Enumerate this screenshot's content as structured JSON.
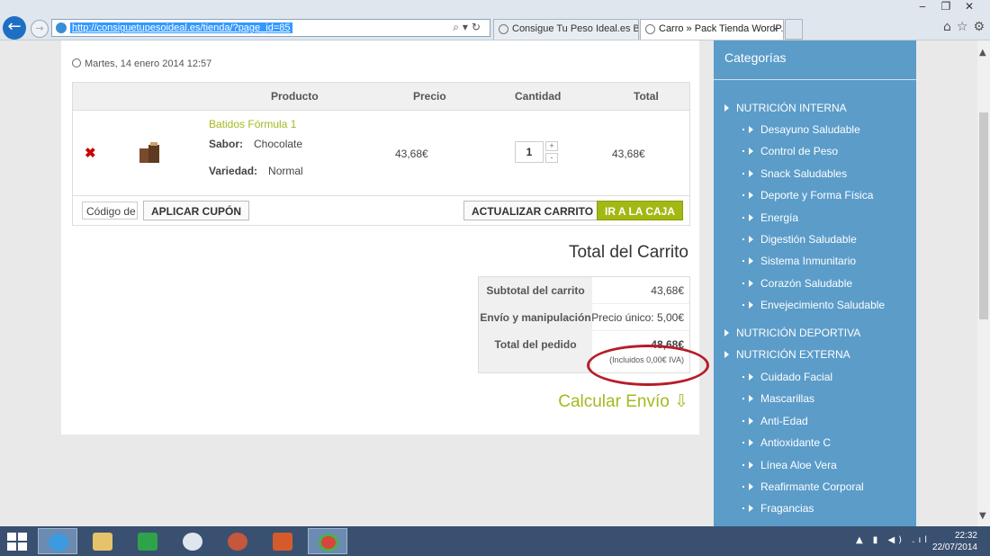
{
  "browser": {
    "url": "http://consiguetupesoideal.es/tienda/?page_id=85",
    "tabs": [
      {
        "label": "Consigue Tu Peso Ideal.es Bus..."
      },
      {
        "label": "Carro » Pack Tienda WordP..."
      }
    ],
    "win_controls": {
      "minimize": "‒",
      "restore": "❐",
      "close": "✕"
    },
    "nav_icons": {
      "home": "⌂",
      "favorites": "☆",
      "settings": "⚙"
    }
  },
  "page": {
    "date": "Martes, 14 enero 2014 12:57",
    "cart": {
      "headers": {
        "product": "Producto",
        "price": "Precio",
        "quantity": "Cantidad",
        "total": "Total"
      },
      "item": {
        "name": "Batidos Fórmula 1",
        "flavor_label": "Sabor:",
        "flavor_value": "Chocolate",
        "variety_label": "Variedad:",
        "variety_value": "Normal",
        "price": "43,68€",
        "quantity": "1",
        "total": "43,68€",
        "remove": "✖"
      },
      "coupon_placeholder": "Código de",
      "apply_coupon": "APLICAR CUPÓN",
      "update_cart": "ACTUALIZAR CARRITO",
      "checkout": "IR A LA CAJA"
    },
    "totals": {
      "title": "Total del Carrito",
      "subtotal_label": "Subtotal del carrito",
      "subtotal_value": "43,68€",
      "shipping_label": "Envío y manipulación",
      "shipping_value": "Precio único: 5,00€",
      "order_total_label": "Total del pedido",
      "order_total_value": "48,68€",
      "tax_note": "(Incluidos 0,00€ IVA)"
    },
    "calc_shipping": "Calcular Envío",
    "calc_arrow": "⇩"
  },
  "sidebar": {
    "title": "Categorías",
    "categories": [
      "NUTRICIÓN INTERNA",
      "Desayuno Saludable",
      "Control de Peso",
      "Snack Saludables",
      "Deporte y Forma Física",
      "Energía",
      "Digestión Saludable",
      "Sistema Inmunitario",
      "Corazón Saludable",
      "Envejecimiento Saludable",
      "NUTRICIÓN DEPORTIVA",
      "NUTRICIÓN EXTERNA",
      "Cuidado Facial",
      "Mascarillas",
      "Anti-Edad",
      "Antioxidante C",
      "Línea Aloe Vera",
      "Reafirmante Corporal",
      "Fragancias"
    ]
  },
  "taskbar": {
    "time": "22:32",
    "date": "22/07/2014",
    "tray": "▲ ▮ ◀) .ıl"
  },
  "colors": {
    "accent": "#a6b81f",
    "sidebar": "#5b9cc9",
    "annotation": "#b61d2a"
  }
}
